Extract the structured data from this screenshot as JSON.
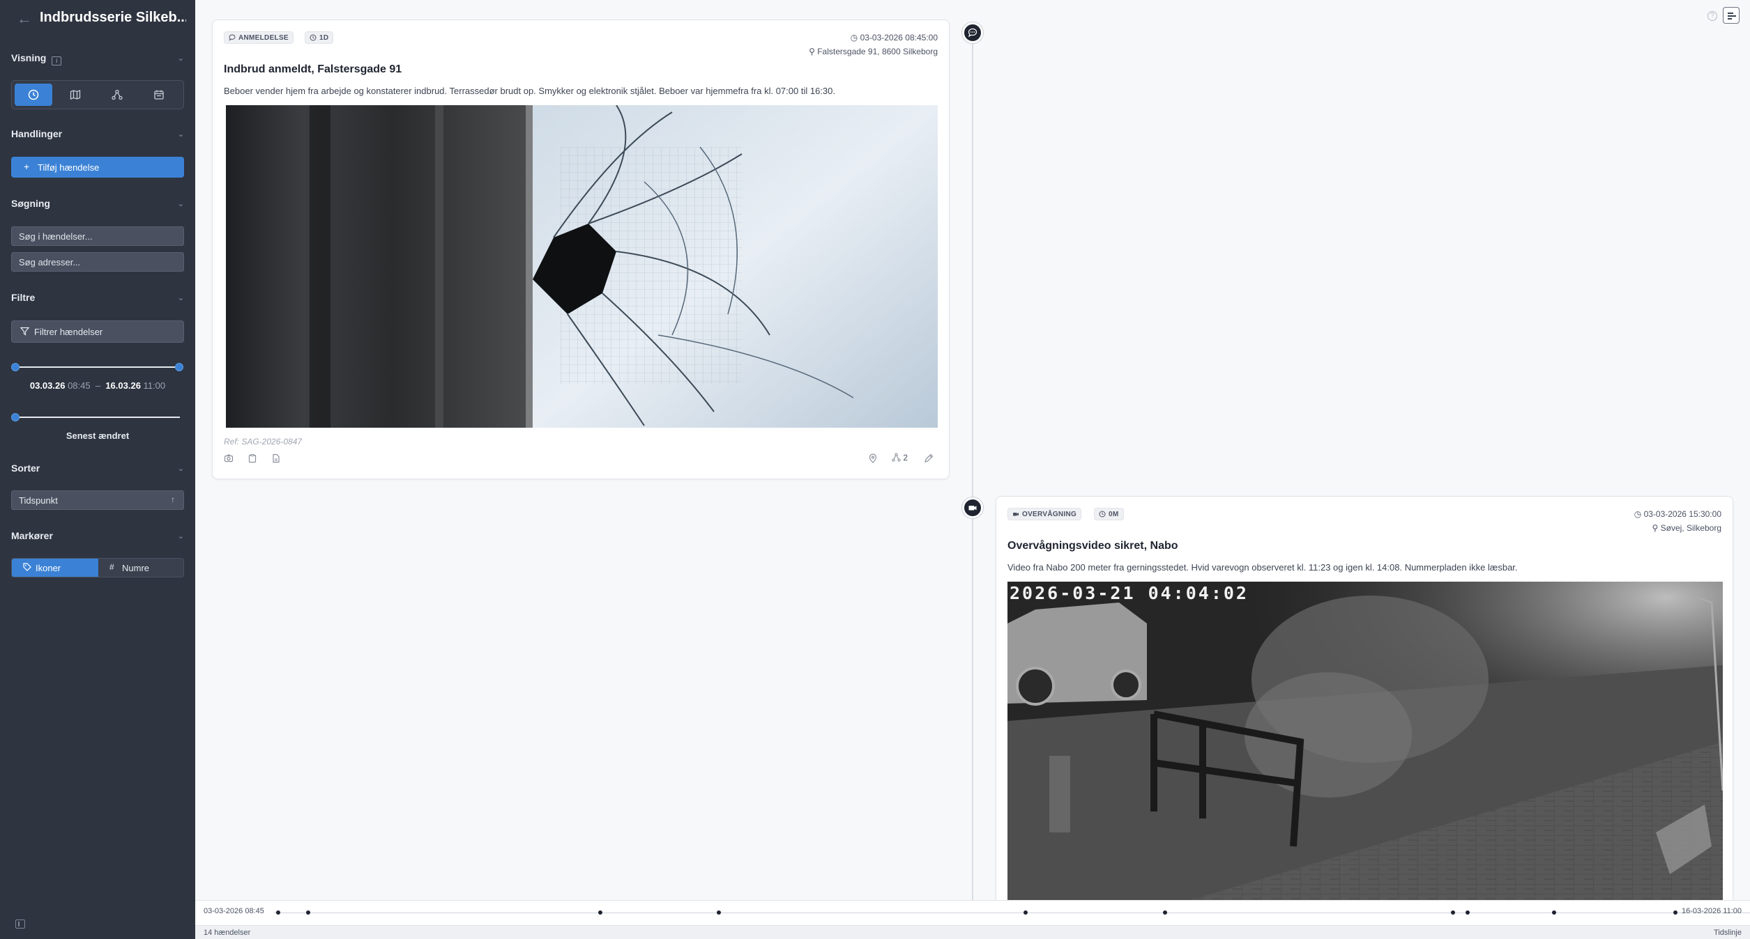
{
  "sidebar": {
    "title": "Indbrudsserie Silkeb...",
    "sections": {
      "visning": "Visning",
      "handlinger": "Handlinger",
      "sogning": "Søgning",
      "filtre": "Filtre",
      "sorter": "Sorter",
      "markorer": "Markører"
    },
    "add_event_label": "Tilføj hændelse",
    "search_events_placeholder": "Søg i hændelser...",
    "search_address_placeholder": "Søg adresser...",
    "filter_label": "Filtrer hændelser",
    "range": {
      "start_date": "03.03.26",
      "start_time": "08:45",
      "separator": "–",
      "end_date": "16.03.26",
      "end_time": "11:00"
    },
    "recency_label": "Senest ændret",
    "sort_value": "Tidspunkt",
    "markers": {
      "icons_label": "Ikoner",
      "numbers_label": "Numre"
    }
  },
  "events": [
    {
      "type_badge": "ANMELDELSE",
      "duration_badge": "1D",
      "datetime": "03-03-2026 08:45:00",
      "location": "Falstersgade 91, 8600 Silkeborg",
      "title": "Indbrud anmeldt, Falstersgade 91",
      "description": "Beboer vender hjem fra arbejde og konstaterer indbrud. Terrassedør brudt op. Smykker og elektronik stjålet. Beboer var hjemmefra fra kl. 07:00 til 16:30.",
      "reference": "Ref: SAG-2026-0847",
      "link_count": "2"
    },
    {
      "type_badge": "OVERVÅGNING",
      "duration_badge": "0M",
      "datetime": "03-03-2026 15:30:00",
      "location": "Søvej, Silkeborg",
      "title": "Overvågningsvideo sikret, Nabo",
      "description": "Video fra Nabo 200 meter fra gerningsstedet. Hvid varevogn observeret kl. 11:23 og igen kl. 14:08. Nummerpladen ikke læsbar.",
      "cctv_timestamp": "2026-03-21 04:04:02"
    }
  ],
  "timeline": {
    "start_label": "03-03-2026 08:45",
    "end_label": "16-03-2026 11:00"
  },
  "status": {
    "count": "14 hændelser",
    "view": "Tidslinje"
  },
  "colors": {
    "sidebar_bg": "#2e3440",
    "accent": "#3b82d6",
    "canvas": "#f7f8fa"
  }
}
